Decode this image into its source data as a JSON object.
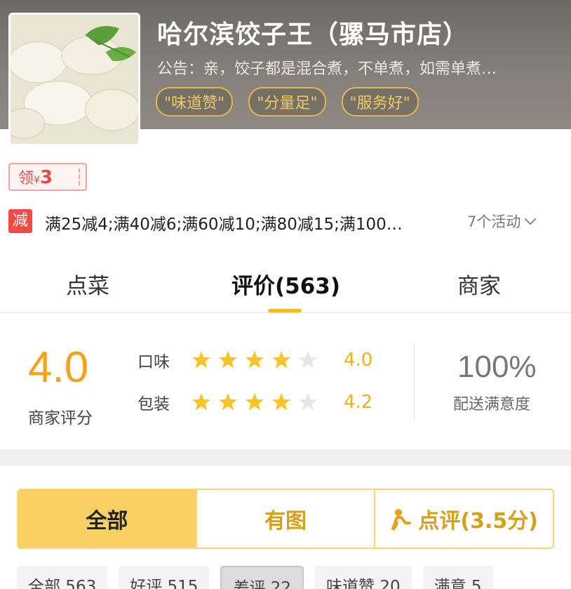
{
  "shop": {
    "title": "哈尔滨饺子王（骡马市店）",
    "notice": "公告：亲，饺子都是混合煮，不单煮，如需单煮…",
    "tags": [
      "\"味道赞\"",
      "\"分量足\"",
      "\"服务好\""
    ]
  },
  "coupon": {
    "prefix": "领",
    "currency": "¥",
    "amount": "3"
  },
  "promo": {
    "badge": "减",
    "text": "满25减4;满40减6;满60减10;满80减15;满100…",
    "more": "7个活动"
  },
  "tabs": [
    {
      "label": "点菜",
      "active": false
    },
    {
      "label": "评价(563)",
      "active": true
    },
    {
      "label": "商家",
      "active": false
    }
  ],
  "rating": {
    "score": "4.0",
    "score_label": "商家评分",
    "rows": [
      {
        "label": "口味",
        "stars": 4,
        "value": "4.0"
      },
      {
        "label": "包装",
        "stars": 4,
        "value": "4.2"
      }
    ],
    "satisfaction": "100%",
    "satisfaction_label": "配送满意度"
  },
  "filter": {
    "segments": [
      "全部",
      "有图",
      "点评(3.5分)"
    ],
    "active_index": 0
  },
  "chips": [
    "全部 563",
    "好评 515",
    "差评 22",
    "味道赞 20",
    "满意 5"
  ],
  "colors": {
    "accent": "#f5b921",
    "score": "#f4a21a",
    "promo": "#f24a45"
  }
}
